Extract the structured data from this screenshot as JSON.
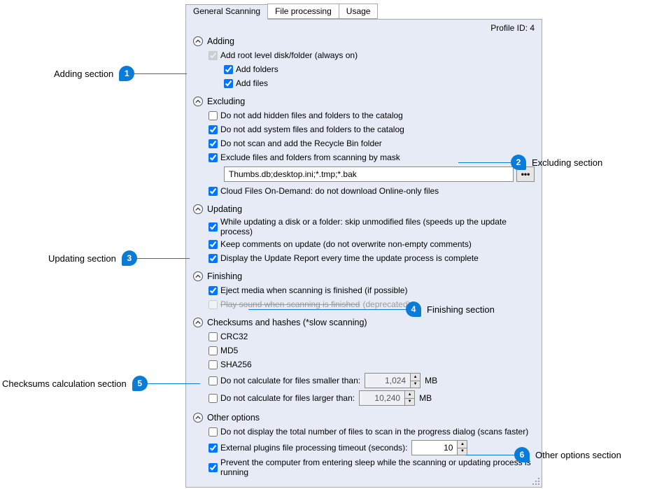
{
  "tabs": {
    "general": "General Scanning",
    "file": "File processing",
    "usage": "Usage"
  },
  "profile_id": "Profile ID: 4",
  "sections": {
    "adding": {
      "title": "Adding",
      "root": "Add root level disk/folder (always on)",
      "folders": "Add folders",
      "files": "Add files"
    },
    "excluding": {
      "title": "Excluding",
      "hidden": "Do not add hidden files and folders to the catalog",
      "system": "Do not add system files and folders to the catalog",
      "recycle": "Do not scan and add the Recycle Bin folder",
      "mask_label": "Exclude files and folders from scanning by mask",
      "mask_value": "Thumbs.db;desktop.ini;*.tmp;*.bak",
      "ellipsis": "•••",
      "cloud": "Cloud Files On-Demand: do not download Online-only files"
    },
    "updating": {
      "title": "Updating",
      "skip": "While updating a disk or a folder: skip unmodified files (speeds up the update process)",
      "keep": "Keep comments on update (do not overwrite non-empty comments)",
      "report": "Display the Update Report every time the update process is complete"
    },
    "finishing": {
      "title": "Finishing",
      "eject": "Eject media when scanning is finished (if possible)",
      "sound": "Play sound when scanning is finished",
      "deprecated": "(deprecated)"
    },
    "checksums": {
      "title": "Checksums and hashes (*slow scanning)",
      "crc": "CRC32",
      "md5": "MD5",
      "sha": "SHA256",
      "smaller": "Do not calculate for files smaller than:",
      "larger": "Do not calculate for files larger than:",
      "val_small": "1,024",
      "val_large": "10,240",
      "unit": "MB"
    },
    "other": {
      "title": "Other options",
      "total": "Do not display the total number of files to scan in the progress dialog (scans faster)",
      "timeout": "External plugins file processing timeout (seconds):",
      "timeout_val": "10",
      "sleep": "Prevent the computer from entering sleep while the scanning or updating process is running"
    }
  },
  "callouts": {
    "c1": "Adding section",
    "c2": "Excluding section",
    "c3": "Updating section",
    "c4": "Finishing section",
    "c5": "Checksums calculation section",
    "c6": "Other options section"
  }
}
